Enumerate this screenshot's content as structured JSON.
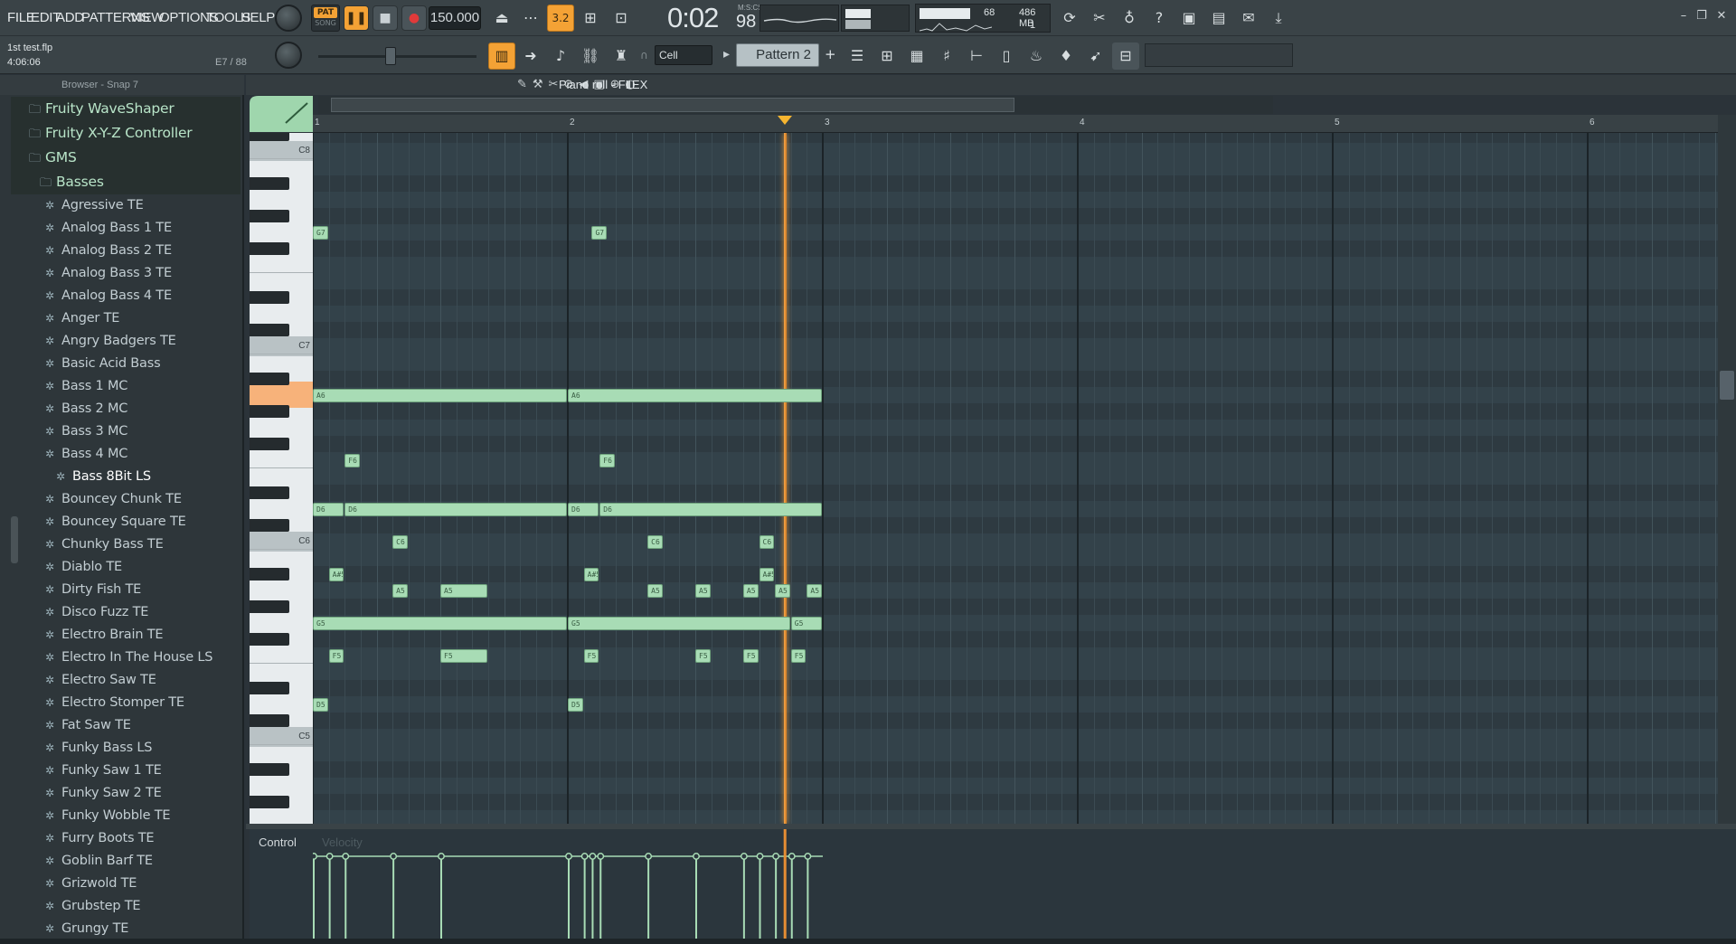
{
  "menu": [
    "FILE",
    "EDIT",
    "ADD",
    "PATTERNS",
    "VIEW",
    "OPTIONS",
    "TOOLS",
    "HELP"
  ],
  "pat_song": {
    "pat": "PAT",
    "song": "SONG"
  },
  "tempo": "150.000",
  "time": {
    "main": "0:02",
    "cs": "98",
    "label": "M:S:CS"
  },
  "cpu": {
    "value": "68",
    "memory": "486 MB",
    "poly": "1"
  },
  "song": {
    "name": "1st test.flp",
    "time": "4:06:06",
    "position": "E7 / 88"
  },
  "snap": "Cell",
  "pattern": "Pattern 2",
  "browser": {
    "header": "Browser - Snap 7",
    "items": [
      {
        "label": "Fruity WaveShaper",
        "kind": "folder",
        "indent": 0
      },
      {
        "label": "Fruity X-Y-Z Controller",
        "kind": "folder",
        "indent": 0
      },
      {
        "label": "GMS",
        "kind": "folder",
        "indent": 0
      },
      {
        "label": "Basses",
        "kind": "folder",
        "indent": 1
      },
      {
        "label": "Agressive TE",
        "kind": "preset",
        "indent": 1
      },
      {
        "label": "Analog Bass 1 TE",
        "kind": "preset",
        "indent": 1
      },
      {
        "label": "Analog Bass 2 TE",
        "kind": "preset",
        "indent": 1
      },
      {
        "label": "Analog Bass 3 TE",
        "kind": "preset",
        "indent": 1
      },
      {
        "label": "Analog Bass 4 TE",
        "kind": "preset",
        "indent": 1
      },
      {
        "label": "Anger TE",
        "kind": "preset",
        "indent": 1
      },
      {
        "label": "Angry Badgers TE",
        "kind": "preset",
        "indent": 1
      },
      {
        "label": "Basic Acid Bass",
        "kind": "preset",
        "indent": 1
      },
      {
        "label": "Bass 1 MC",
        "kind": "preset",
        "indent": 1
      },
      {
        "label": "Bass 2 MC",
        "kind": "preset",
        "indent": 1
      },
      {
        "label": "Bass 3 MC",
        "kind": "preset",
        "indent": 1
      },
      {
        "label": "Bass 4 MC",
        "kind": "preset",
        "indent": 1
      },
      {
        "label": "Bass 8Bit LS",
        "kind": "preset",
        "indent": 2,
        "selected": true
      },
      {
        "label": "Bouncey Chunk TE",
        "kind": "preset",
        "indent": 1
      },
      {
        "label": "Bouncey Square TE",
        "kind": "preset",
        "indent": 1
      },
      {
        "label": "Chunky Bass TE",
        "kind": "preset",
        "indent": 1
      },
      {
        "label": "Diablo TE",
        "kind": "preset",
        "indent": 1
      },
      {
        "label": "Dirty Fish TE",
        "kind": "preset",
        "indent": 1
      },
      {
        "label": "Disco Fuzz TE",
        "kind": "preset",
        "indent": 1
      },
      {
        "label": "Electro Brain TE",
        "kind": "preset",
        "indent": 1
      },
      {
        "label": "Electro In The House LS",
        "kind": "preset",
        "indent": 1
      },
      {
        "label": "Electro Saw TE",
        "kind": "preset",
        "indent": 1
      },
      {
        "label": "Electro Stomper TE",
        "kind": "preset",
        "indent": 1
      },
      {
        "label": "Fat Saw TE",
        "kind": "preset",
        "indent": 1
      },
      {
        "label": "Funky Bass LS",
        "kind": "preset",
        "indent": 1
      },
      {
        "label": "Funky Saw 1 TE",
        "kind": "preset",
        "indent": 1
      },
      {
        "label": "Funky Saw 2 TE",
        "kind": "preset",
        "indent": 1
      },
      {
        "label": "Funky Wobble TE",
        "kind": "preset",
        "indent": 1
      },
      {
        "label": "Furry Boots TE",
        "kind": "preset",
        "indent": 1
      },
      {
        "label": "Goblin Barf TE",
        "kind": "preset",
        "indent": 1
      },
      {
        "label": "Grizwold TE",
        "kind": "preset",
        "indent": 1
      },
      {
        "label": "Grubstep TE",
        "kind": "preset",
        "indent": 1
      },
      {
        "label": "Grungy TE",
        "kind": "preset",
        "indent": 1
      }
    ]
  },
  "piano_roll": {
    "title": "Piano roll - FLEX",
    "bars": [
      "1",
      "2",
      "3",
      "4",
      "5",
      "6"
    ],
    "octave_labels": [
      "C8",
      "C7",
      "C6",
      "C5"
    ],
    "active_key": "A6",
    "playhead_bar": 2.85,
    "notes": [
      {
        "pitch": "G7",
        "start": 0,
        "len": 1
      },
      {
        "pitch": "G7",
        "start": 17.5,
        "len": 1
      },
      {
        "pitch": "A6",
        "start": 0,
        "len": 16
      },
      {
        "pitch": "A6",
        "start": 16,
        "len": 16
      },
      {
        "pitch": "F6",
        "start": 2,
        "len": 1
      },
      {
        "pitch": "F6",
        "start": 18,
        "len": 1
      },
      {
        "pitch": "D6",
        "start": 0,
        "len": 2
      },
      {
        "pitch": "D6",
        "start": 2,
        "len": 14
      },
      {
        "pitch": "D6",
        "start": 16,
        "len": 2
      },
      {
        "pitch": "D6",
        "start": 18,
        "len": 14
      },
      {
        "pitch": "C6",
        "start": 5,
        "len": 1
      },
      {
        "pitch": "C6",
        "start": 21,
        "len": 1
      },
      {
        "pitch": "C6",
        "start": 28,
        "len": 1
      },
      {
        "pitch": "A#5",
        "start": 1,
        "len": 1
      },
      {
        "pitch": "A#5",
        "start": 17,
        "len": 1
      },
      {
        "pitch": "A#5",
        "start": 28,
        "len": 1
      },
      {
        "pitch": "A5",
        "start": 5,
        "len": 1
      },
      {
        "pitch": "A5",
        "start": 8,
        "len": 3
      },
      {
        "pitch": "A5",
        "start": 21,
        "len": 1
      },
      {
        "pitch": "A5",
        "start": 24,
        "len": 1
      },
      {
        "pitch": "A5",
        "start": 27,
        "len": 1
      },
      {
        "pitch": "A5",
        "start": 29,
        "len": 1
      },
      {
        "pitch": "A5",
        "start": 31,
        "len": 1
      },
      {
        "pitch": "G5",
        "start": 0,
        "len": 16
      },
      {
        "pitch": "G5",
        "start": 16,
        "len": 14
      },
      {
        "pitch": "G5",
        "start": 30,
        "len": 2
      },
      {
        "pitch": "F5",
        "start": 1,
        "len": 1
      },
      {
        "pitch": "F5",
        "start": 8,
        "len": 3
      },
      {
        "pitch": "F5",
        "start": 17,
        "len": 1
      },
      {
        "pitch": "F5",
        "start": 24,
        "len": 1
      },
      {
        "pitch": "F5",
        "start": 27,
        "len": 1
      },
      {
        "pitch": "F5",
        "start": 30,
        "len": 1
      },
      {
        "pitch": "D5",
        "start": 0,
        "len": 1
      },
      {
        "pitch": "D5",
        "start": 16,
        "len": 1
      }
    ]
  },
  "control": {
    "label": "Control",
    "target": "Velocity"
  },
  "colors": {
    "accent": "#f4a235",
    "note": "#a8dcb5",
    "playhead": "#f5a64a"
  }
}
